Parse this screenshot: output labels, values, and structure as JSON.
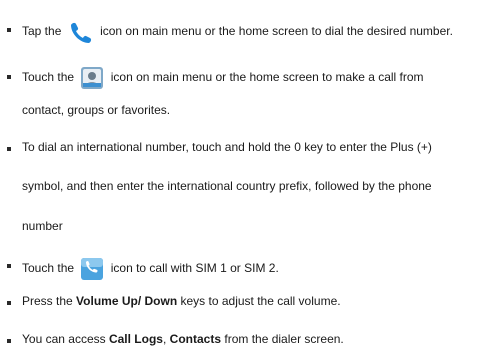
{
  "items": [
    {
      "lines": [
        {
          "pre": "Tap the",
          "icon": "phone-icon",
          "post": "icon on main menu or the home screen to dial the desired number."
        }
      ]
    },
    {
      "lines": [
        {
          "pre": "Touch the",
          "icon": "contacts-icon",
          "post": "icon on main menu or the home screen to make a call from"
        },
        {
          "text": "contact, groups or favorites."
        }
      ]
    },
    {
      "lines": [
        {
          "text": "To dial an international number, touch and hold the 0 key to enter the Plus (+)"
        },
        {
          "text": "symbol, and then enter the international country prefix, followed by the phone"
        },
        {
          "text": "number"
        }
      ]
    },
    {
      "lines": [
        {
          "pre": "Touch the",
          "icon": "sim-call-icon",
          "post": "icon to call with SIM 1 or SIM 2."
        }
      ]
    },
    {
      "lines": [
        {
          "pre": "Press the",
          "bold": "Volume Up/ Down",
          "post": "keys to adjust the call volume."
        }
      ]
    },
    {
      "lines": [
        {
          "pre": "You can access",
          "bold": "Call Logs",
          "mid": ",",
          "bold2": "Contacts",
          "post": "from the dialer screen."
        }
      ]
    }
  ],
  "colors": {
    "text": "#1a1a1a",
    "phone_icon": "#1e86d9",
    "contacts_icon_bg": "#7fa8c8",
    "sim_icon_bg": "#4aa3df"
  }
}
